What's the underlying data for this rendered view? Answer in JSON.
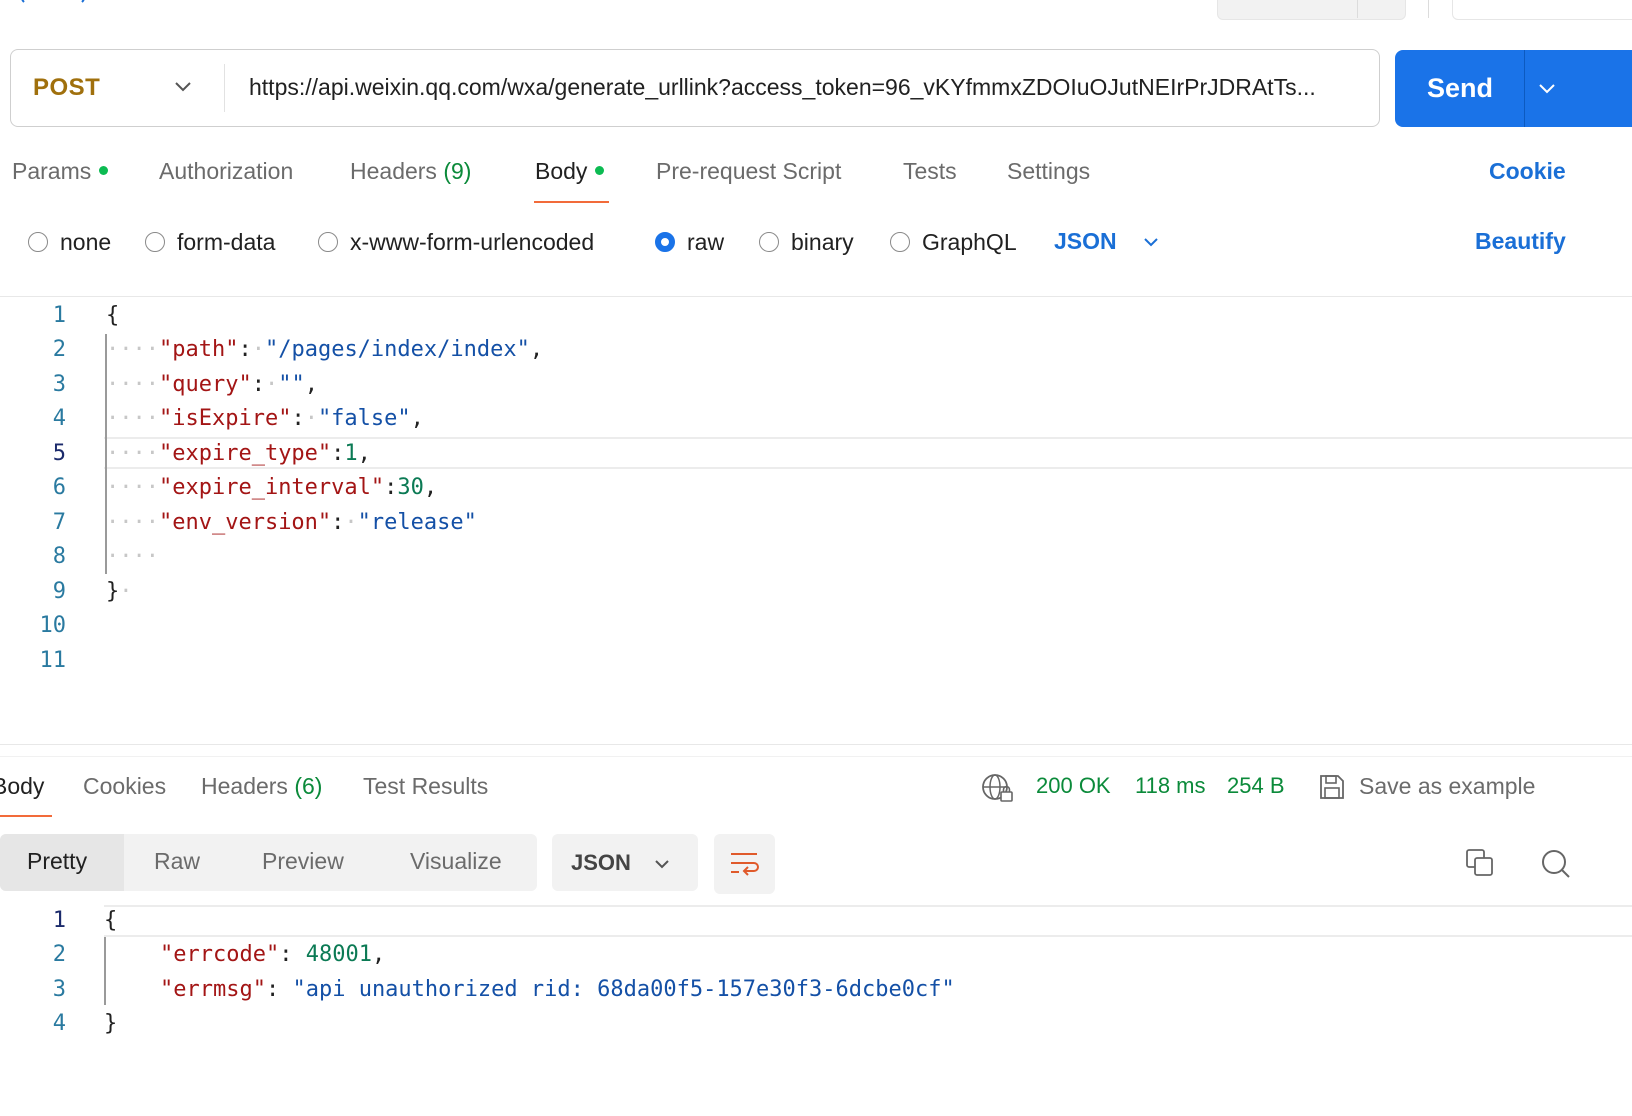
{
  "request": {
    "method": "POST",
    "url": "https://api.weixin.qq.com/wxa/generate_urllink?access_token=96_vKYfmmxZDOIuOJutNEIrPrJDRAtTs...",
    "send_label": "Send"
  },
  "request_tabs": {
    "params": "Params",
    "authorization": "Authorization",
    "headers": "Headers",
    "headers_count": "(9)",
    "body": "Body",
    "prerequest": "Pre-request Script",
    "tests": "Tests",
    "settings": "Settings",
    "cookies": "Cookie"
  },
  "body_types": {
    "none": "none",
    "form_data": "form-data",
    "urlencoded": "x-www-form-urlencoded",
    "raw": "raw",
    "binary": "binary",
    "graphql": "GraphQL",
    "selected": "raw",
    "format": "JSON",
    "beautify": "Beautify"
  },
  "request_body": {
    "line_numbers": [
      "1",
      "2",
      "3",
      "4",
      "5",
      "6",
      "7",
      "8",
      "9",
      "10",
      "11"
    ],
    "open_brace": "{",
    "close_brace": "}",
    "lines": [
      {
        "key": "\"path\"",
        "value": "\"/pages/index/index\"",
        "trail": ","
      },
      {
        "key": "\"query\"",
        "value": "\"\"",
        "trail": ","
      },
      {
        "key": "\"isExpire\"",
        "value": "\"false\"",
        "trail": ","
      },
      {
        "key": "\"expire_type\"",
        "value": "1",
        "trail": ","
      },
      {
        "key": "\"expire_interval\"",
        "value": "30",
        "trail": ","
      },
      {
        "key": "\"env_version\"",
        "value": "\"release\"",
        "trail": ""
      }
    ]
  },
  "response_tabs": {
    "body": "Body",
    "cookies": "Cookies",
    "headers": "Headers",
    "headers_count": "(6)",
    "test_results": "Test Results"
  },
  "response_status": {
    "status": "200 OK",
    "time": "118 ms",
    "size": "254 B",
    "save_example": "Save as example"
  },
  "response_view": {
    "pretty": "Pretty",
    "raw": "Raw",
    "preview": "Preview",
    "visualize": "Visualize",
    "format": "JSON"
  },
  "response_body": {
    "line_numbers": [
      "1",
      "2",
      "3",
      "4"
    ],
    "open_brace": "{",
    "close_brace": "}",
    "errcode_key": "\"errcode\"",
    "errcode_value": "48001",
    "errmsg_key": "\"errmsg\"",
    "errmsg_value": "\"api unauthorized rid: 68da00f5-157e30f3-6dcbe0cf\""
  },
  "icons": [
    "chevron-down-icon",
    "globe-icon",
    "save-icon",
    "copy-icon",
    "search-icon",
    "wrap-lines-icon"
  ],
  "colors": {
    "accent": "#1a73e8",
    "method": "#a0700d",
    "status_ok": "#0b8a3a",
    "active_tab": "#f26b3a"
  }
}
